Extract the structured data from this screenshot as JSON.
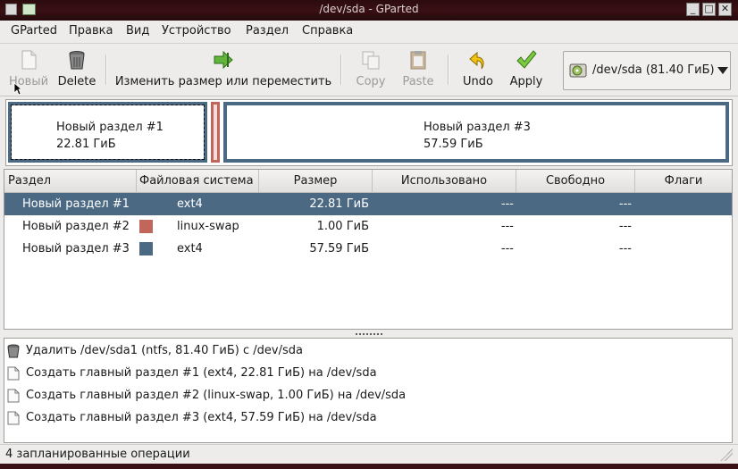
{
  "window": {
    "title": "/dev/sda - GParted"
  },
  "menubar": {
    "items": [
      {
        "label": "GParted"
      },
      {
        "label": "Правка"
      },
      {
        "label": "Вид"
      },
      {
        "label": "Устройство"
      },
      {
        "label": "Раздел"
      },
      {
        "label": "Справка"
      }
    ]
  },
  "toolbar": {
    "new_label": "Новый",
    "delete_label": "Delete",
    "resize_label": "Изменить размер или переместить",
    "copy_label": "Copy",
    "paste_label": "Paste",
    "undo_label": "Undo",
    "apply_label": "Apply",
    "device_label": "/dev/sda  (81.40 ГиБ)"
  },
  "partition_map": [
    {
      "name": "Новый раздел #1",
      "size": "22.81 ГиБ"
    },
    {
      "name": "Новый раздел #3",
      "size": "57.59 ГиБ"
    }
  ],
  "table": {
    "headers": [
      "Раздел",
      "Файловая система",
      "Размер",
      "Использовано",
      "Свободно",
      "Флаги"
    ],
    "rows": [
      {
        "partition": "Новый раздел #1",
        "fs": "ext4",
        "size": "22.81 ГиБ",
        "used": "---",
        "free": "---",
        "color": "#4b6983"
      },
      {
        "partition": "Новый раздел #2",
        "fs": "linux-swap",
        "size": "1.00 ГиБ",
        "used": "---",
        "free": "---",
        "color": "#c1665a"
      },
      {
        "partition": "Новый раздел #3",
        "fs": "ext4",
        "size": "57.59 ГиБ",
        "used": "---",
        "free": "---",
        "color": "#4b6983"
      }
    ]
  },
  "operations": [
    {
      "text": "Удалить /dev/sda1 (ntfs, 81.40 ГиБ) с /dev/sda",
      "icon": "trash-icon"
    },
    {
      "text": "Создать главный раздел #1 (ext4, 22.81 ГиБ) на /dev/sda",
      "icon": "new-document-icon"
    },
    {
      "text": "Создать главный раздел #2 (linux-swap, 1.00 ГиБ) на /dev/sda",
      "icon": "new-document-icon"
    },
    {
      "text": "Создать главный раздел #3 (ext4, 57.59 ГиБ) на /dev/sda",
      "icon": "new-document-icon"
    }
  ],
  "status": {
    "text": "4 запланированные операции"
  },
  "colors": {
    "selection": "#4b6983",
    "ext4": "#4b6983",
    "swap": "#c1665a"
  }
}
